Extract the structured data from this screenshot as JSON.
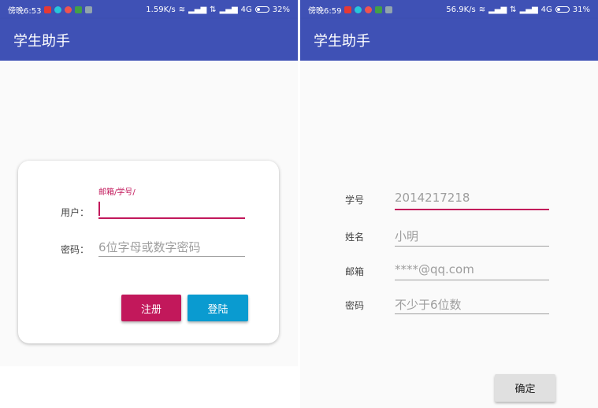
{
  "colors": {
    "primary": "#3f51b5",
    "accent": "#c2185b",
    "register_button": "#c2185b",
    "login_button": "#0a9bd0"
  },
  "left": {
    "status": {
      "time": "傍晚6:53",
      "speed": "1.59K/s",
      "network": "4G",
      "battery": "32%",
      "battery_level": 0.32
    },
    "title": "学生助手",
    "user_float_label": "邮箱/学号/",
    "user_label": "用户：",
    "password_label": "密码：",
    "password_hint": "6位字母或数字密码",
    "register_label": "注册",
    "login_label": "登陆"
  },
  "right": {
    "status": {
      "time": "傍晚6:59",
      "speed": "56.9K/s",
      "network": "4G",
      "battery": "31%",
      "battery_level": 0.31
    },
    "title": "学生助手",
    "fields": [
      {
        "label": "学号",
        "value": "2014217218"
      },
      {
        "label": "姓名",
        "value": "小明"
      },
      {
        "label": "邮箱",
        "value": "****@qq.com"
      },
      {
        "label": "密码",
        "value": "不少于6位数"
      }
    ],
    "confirm_label": "确定"
  }
}
